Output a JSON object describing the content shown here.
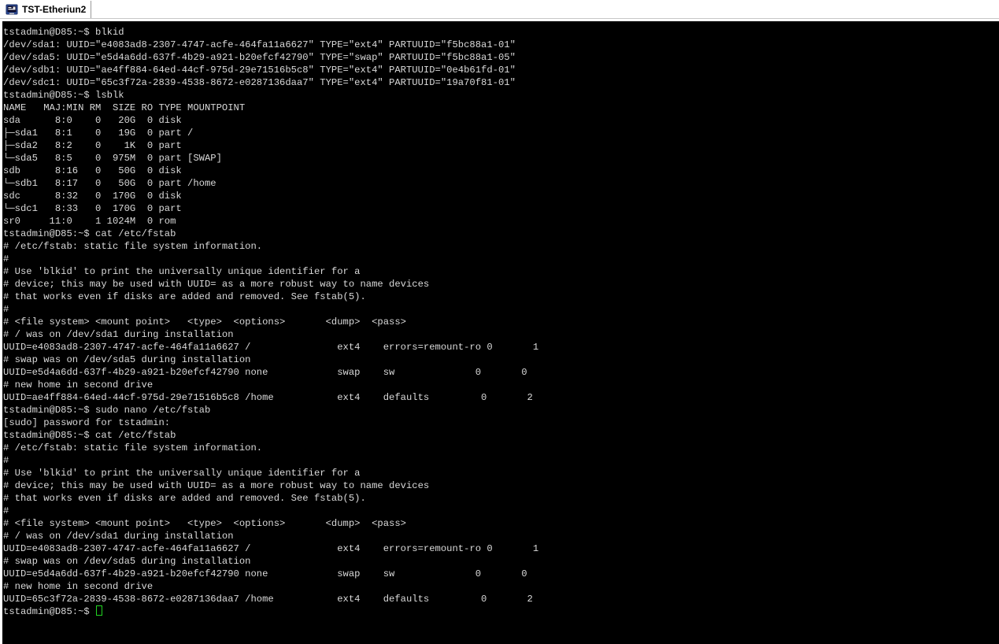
{
  "window": {
    "tab_title": "TST-Etheriun2",
    "tab_icon": "putty-terminal-icon"
  },
  "terminal": {
    "background": "#000000",
    "foreground": "#d9d9d9",
    "cursor_color": "#21d421",
    "lines": [
      "tstadmin@D85:~$ blkid",
      "/dev/sda1: UUID=\"e4083ad8-2307-4747-acfe-464fa11a6627\" TYPE=\"ext4\" PARTUUID=\"f5bc88a1-01\"",
      "/dev/sda5: UUID=\"e5d4a6dd-637f-4b29-a921-b20efcf42790\" TYPE=\"swap\" PARTUUID=\"f5bc88a1-05\"",
      "/dev/sdb1: UUID=\"ae4ff884-64ed-44cf-975d-29e71516b5c8\" TYPE=\"ext4\" PARTUUID=\"0e4b61fd-01\"",
      "/dev/sdc1: UUID=\"65c3f72a-2839-4538-8672-e0287136daa7\" TYPE=\"ext4\" PARTUUID=\"19a70f81-01\"",
      "tstadmin@D85:~$ lsblk",
      "NAME   MAJ:MIN RM  SIZE RO TYPE MOUNTPOINT",
      "sda      8:0    0   20G  0 disk",
      "├─sda1   8:1    0   19G  0 part /",
      "├─sda2   8:2    0    1K  0 part",
      "└─sda5   8:5    0  975M  0 part [SWAP]",
      "sdb      8:16   0   50G  0 disk",
      "└─sdb1   8:17   0   50G  0 part /home",
      "sdc      8:32   0  170G  0 disk",
      "└─sdc1   8:33   0  170G  0 part",
      "sr0     11:0    1 1024M  0 rom",
      "tstadmin@D85:~$ cat /etc/fstab",
      "# /etc/fstab: static file system information.",
      "#",
      "# Use 'blkid' to print the universally unique identifier for a",
      "# device; this may be used with UUID= as a more robust way to name devices",
      "# that works even if disks are added and removed. See fstab(5).",
      "#",
      "# <file system> <mount point>   <type>  <options>       <dump>  <pass>",
      "# / was on /dev/sda1 during installation",
      "UUID=e4083ad8-2307-4747-acfe-464fa11a6627 /               ext4    errors=remount-ro 0       1",
      "# swap was on /dev/sda5 during installation",
      "UUID=e5d4a6dd-637f-4b29-a921-b20efcf42790 none            swap    sw              0       0",
      "# new home in second drive",
      "UUID=ae4ff884-64ed-44cf-975d-29e71516b5c8 /home           ext4    defaults         0       2",
      "tstadmin@D85:~$ sudo nano /etc/fstab",
      "[sudo] password for tstadmin:",
      "tstadmin@D85:~$ cat /etc/fstab",
      "# /etc/fstab: static file system information.",
      "#",
      "# Use 'blkid' to print the universally unique identifier for a",
      "# device; this may be used with UUID= as a more robust way to name devices",
      "# that works even if disks are added and removed. See fstab(5).",
      "#",
      "# <file system> <mount point>   <type>  <options>       <dump>  <pass>",
      "# / was on /dev/sda1 during installation",
      "UUID=e4083ad8-2307-4747-acfe-464fa11a6627 /               ext4    errors=remount-ro 0       1",
      "# swap was on /dev/sda5 during installation",
      "UUID=e5d4a6dd-637f-4b29-a921-b20efcf42790 none            swap    sw              0       0",
      "# new home in second drive",
      "UUID=65c3f72a-2839-4538-8672-e0287136daa7 /home           ext4    defaults         0       2"
    ],
    "prompt": "tstadmin@D85:~$ "
  }
}
